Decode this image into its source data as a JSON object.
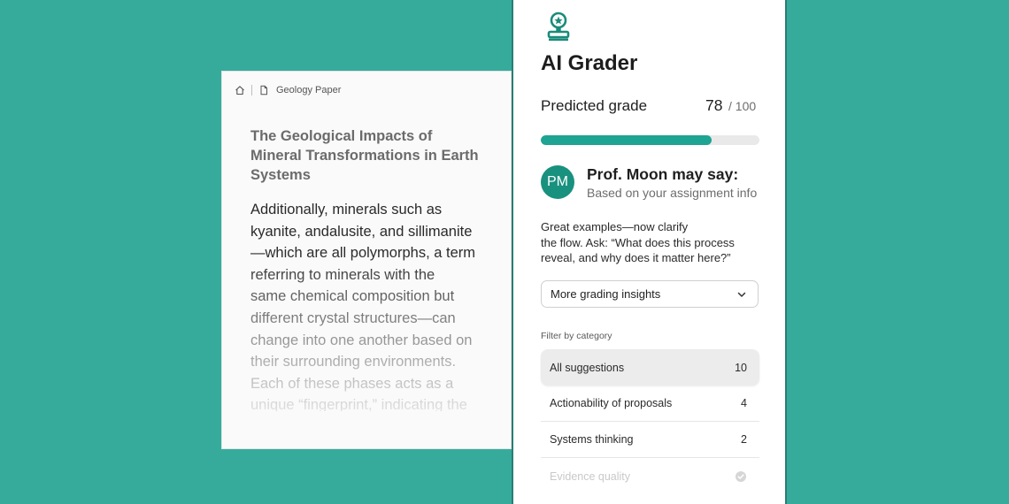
{
  "colors": {
    "background": "#36ab9c",
    "accent": "#1fa392",
    "avatar": "#19917f",
    "panel_border": "#2a7d72"
  },
  "document": {
    "breadcrumb": {
      "home_icon": "home-icon",
      "file_icon": "file-icon",
      "label": "Geology Paper"
    },
    "title_lines": [
      "The Geological Impacts of",
      "Mineral Transformations in Earth",
      "Systems"
    ],
    "body_lines": [
      "Additionally, minerals such as",
      "kyanite, andalusite, and sillimanite",
      "—which are all polymorphs, a term",
      "referring to minerals with the",
      "same chemical composition but",
      "different crystal structures—can",
      "change into one another based on",
      "their surrounding environments.",
      "Each of these phases acts as a",
      "unique “fingerprint,” indicating the"
    ]
  },
  "grader": {
    "logo_icon": "stamp-icon",
    "title": "AI Grader",
    "predicted_label": "Predicted grade",
    "predicted_value": "78",
    "predicted_max": "/ 100",
    "progress_fraction": 0.78,
    "reviewer": {
      "initials": "PM",
      "title": "Prof. Moon may say:",
      "subtitle": "Based on your assignment info"
    },
    "feedback_lines": [
      "Great examples—now clarify",
      "the flow. Ask: “What does this process",
      "reveal, and why does it matter here?”"
    ],
    "dropdown": {
      "label": "More grading insights",
      "icon": "chevron-down-icon"
    },
    "filter_label": "Filter by category",
    "categories": [
      {
        "label": "All suggestions",
        "count": "10"
      },
      {
        "label": "Actionability of proposals",
        "count": "4"
      },
      {
        "label": "Systems thinking",
        "count": "2"
      },
      {
        "label": "Evidence quality",
        "icon": "check-circle-icon"
      }
    ]
  }
}
